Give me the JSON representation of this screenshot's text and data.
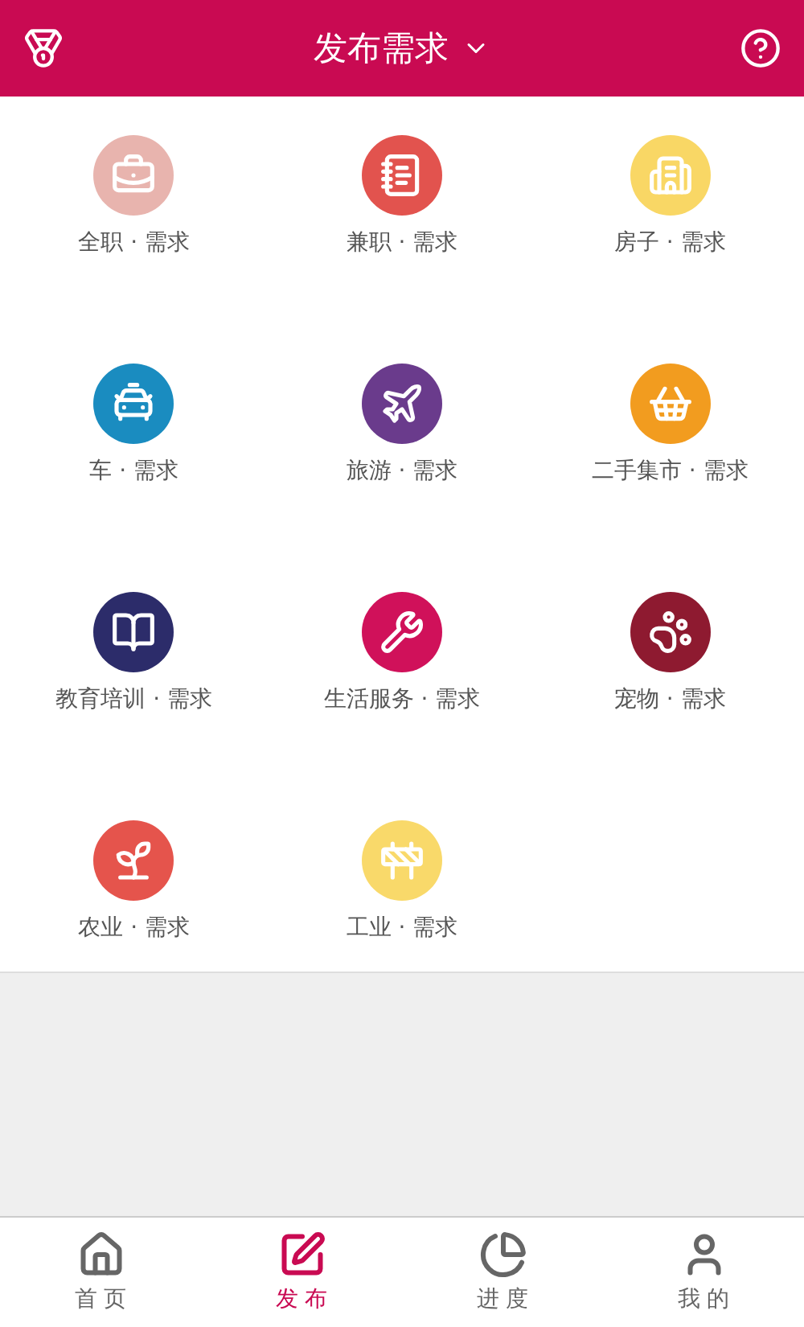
{
  "header": {
    "title": "发布需求"
  },
  "categories": [
    {
      "label": "全职 · 需求",
      "color": "#e8b4ae"
    },
    {
      "label": "兼职 · 需求",
      "color": "#e2534e"
    },
    {
      "label": "房子 · 需求",
      "color": "#f9d765"
    },
    {
      "label": "车 · 需求",
      "color": "#1a8cc0"
    },
    {
      "label": "旅游 · 需求",
      "color": "#6a3b8c"
    },
    {
      "label": "二手集市 · 需求",
      "color": "#f29c1f"
    },
    {
      "label": "教育培训 · 需求",
      "color": "#2c2c6a"
    },
    {
      "label": "生活服务 · 需求",
      "color": "#d0115a"
    },
    {
      "label": "宠物 · 需求",
      "color": "#8e1a30"
    },
    {
      "label": "农业 · 需求",
      "color": "#e5544c"
    },
    {
      "label": "工业 · 需求",
      "color": "#f9d96a"
    }
  ],
  "tabs": [
    {
      "label": "首 页",
      "selected": false
    },
    {
      "label": "发 布",
      "selected": true
    },
    {
      "label": "进 度",
      "selected": false
    },
    {
      "label": "我 的",
      "selected": false
    }
  ]
}
